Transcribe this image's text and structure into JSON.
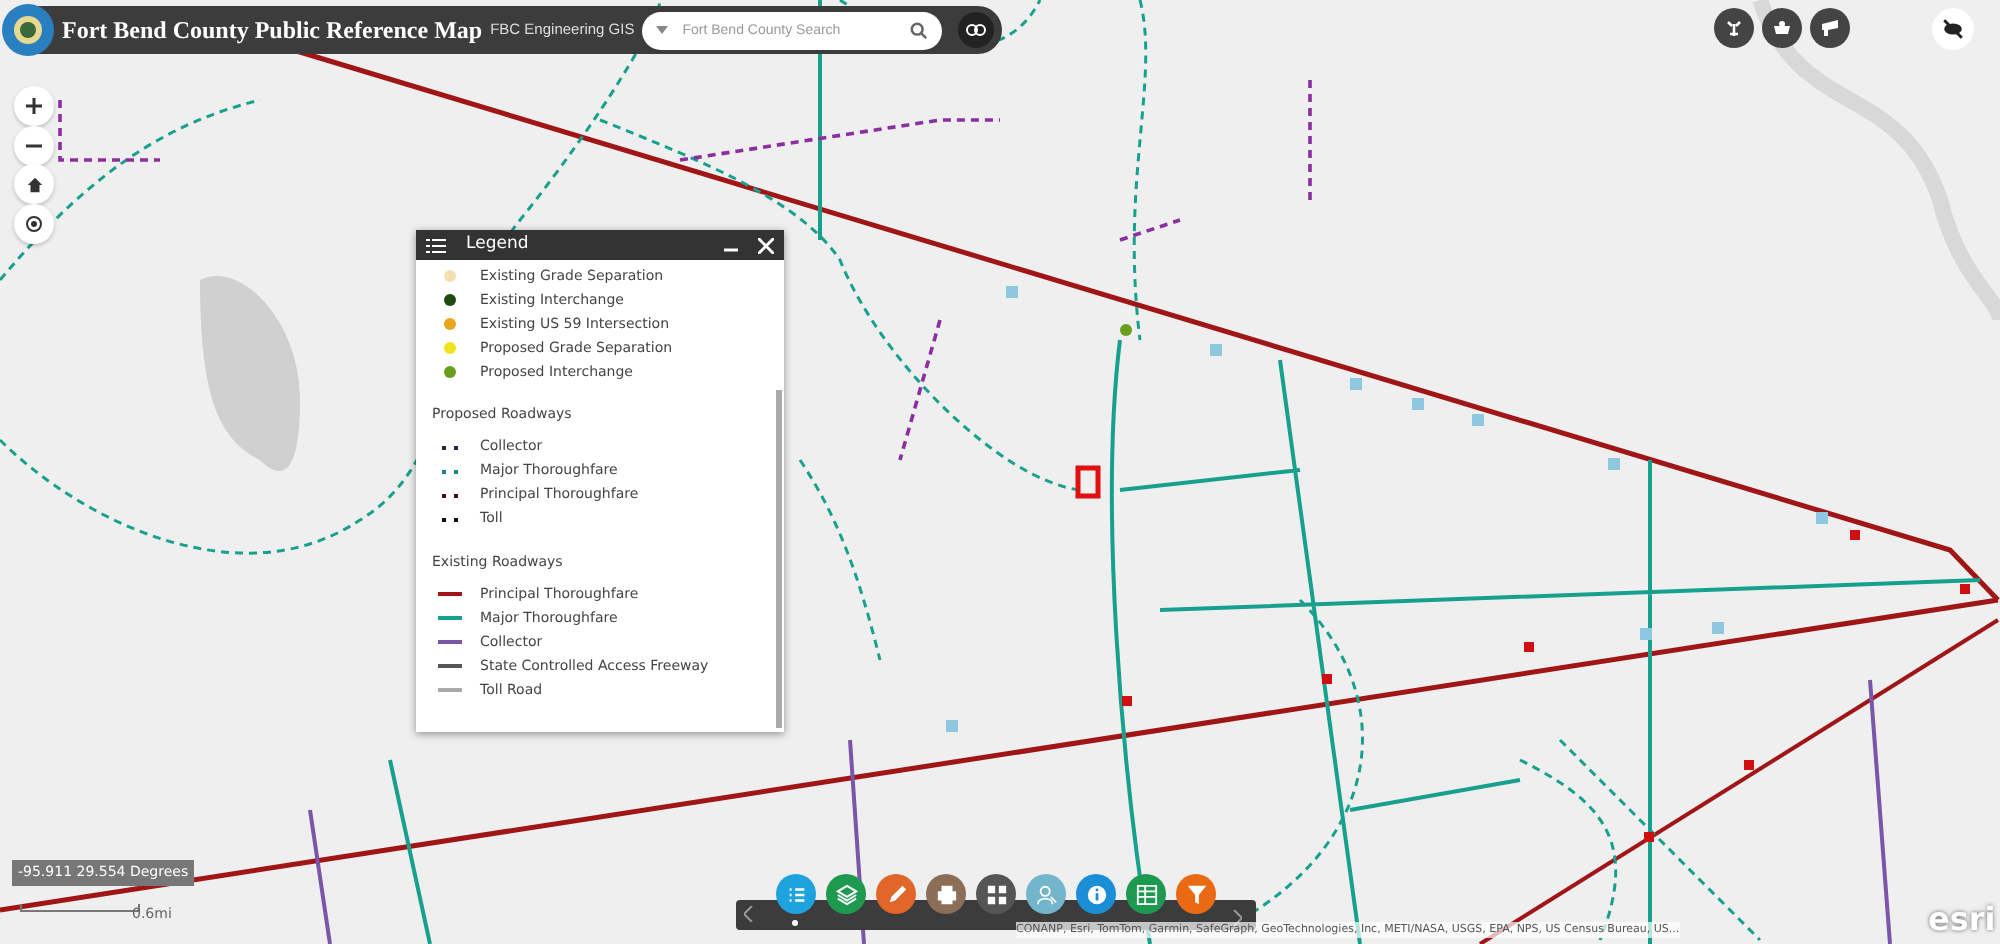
{
  "header": {
    "title": "Fort Bend County Public Reference Map",
    "subtitle": "FBC Engineering GIS",
    "search": {
      "placeholder": "Fort Bend County Search"
    }
  },
  "legend": {
    "title": "Legend",
    "items": [
      {
        "kind": "point",
        "label": "Existing Grade Separation",
        "color": "#f3dfb0"
      },
      {
        "kind": "point",
        "label": "Existing Interchange",
        "color": "#1f4a12"
      },
      {
        "kind": "point",
        "label": "Existing US 59 Intersection",
        "color": "#e8a51f"
      },
      {
        "kind": "point",
        "label": "Proposed Grade Separation",
        "color": "#f0e41c"
      },
      {
        "kind": "point",
        "label": "Proposed Interchange",
        "color": "#6a9e1e"
      },
      {
        "kind": "heading",
        "label": "Proposed Roadways"
      },
      {
        "kind": "dash",
        "label": "Collector",
        "color": "#3a1e4a"
      },
      {
        "kind": "dash",
        "label": "Major Thoroughfare",
        "color": "#1a8a7a"
      },
      {
        "kind": "dash",
        "label": "Principal Thoroughfare",
        "color": "#4a1010"
      },
      {
        "kind": "dash",
        "label": "Toll",
        "color": "#111111"
      },
      {
        "kind": "heading",
        "label": "Existing Roadways"
      },
      {
        "kind": "line",
        "label": "Principal Thoroughfare",
        "color": "#a01515"
      },
      {
        "kind": "line",
        "label": "Major Thoroughfare",
        "color": "#17a08e"
      },
      {
        "kind": "line",
        "label": "Collector",
        "color": "#7a55a8"
      },
      {
        "kind": "line",
        "label": "State Controlled Access Freeway",
        "color": "#555555"
      },
      {
        "kind": "line",
        "label": "Toll Road",
        "color": "#aaaaaa"
      }
    ]
  },
  "coordinates": "-95.911 29.554 Degrees",
  "scale": "0.6mi",
  "toolbar": [
    {
      "kind": "list",
      "color": "#1ea3de",
      "selected": true
    },
    {
      "kind": "layers",
      "color": "#1e9a50",
      "selected": false
    },
    {
      "kind": "pencil",
      "color": "#e0662a",
      "selected": false
    },
    {
      "kind": "printer",
      "color": "#8c6d55",
      "selected": false
    },
    {
      "kind": "grid",
      "color": "#555555",
      "selected": false
    },
    {
      "kind": "person-search",
      "color": "#73b6cc",
      "selected": false
    },
    {
      "kind": "info",
      "color": "#1a8fd6",
      "selected": false
    },
    {
      "kind": "table",
      "color": "#1e9a50",
      "selected": false
    },
    {
      "kind": "filter",
      "color": "#ea6a14",
      "selected": false
    }
  ],
  "attribution": "CONANP, Esri, TomTom, Garmin, SafeGraph, GeoTechnologies, Inc, METI/NASA, USGS, EPA, NPS, US Census Bureau, US...",
  "logo": "esri"
}
